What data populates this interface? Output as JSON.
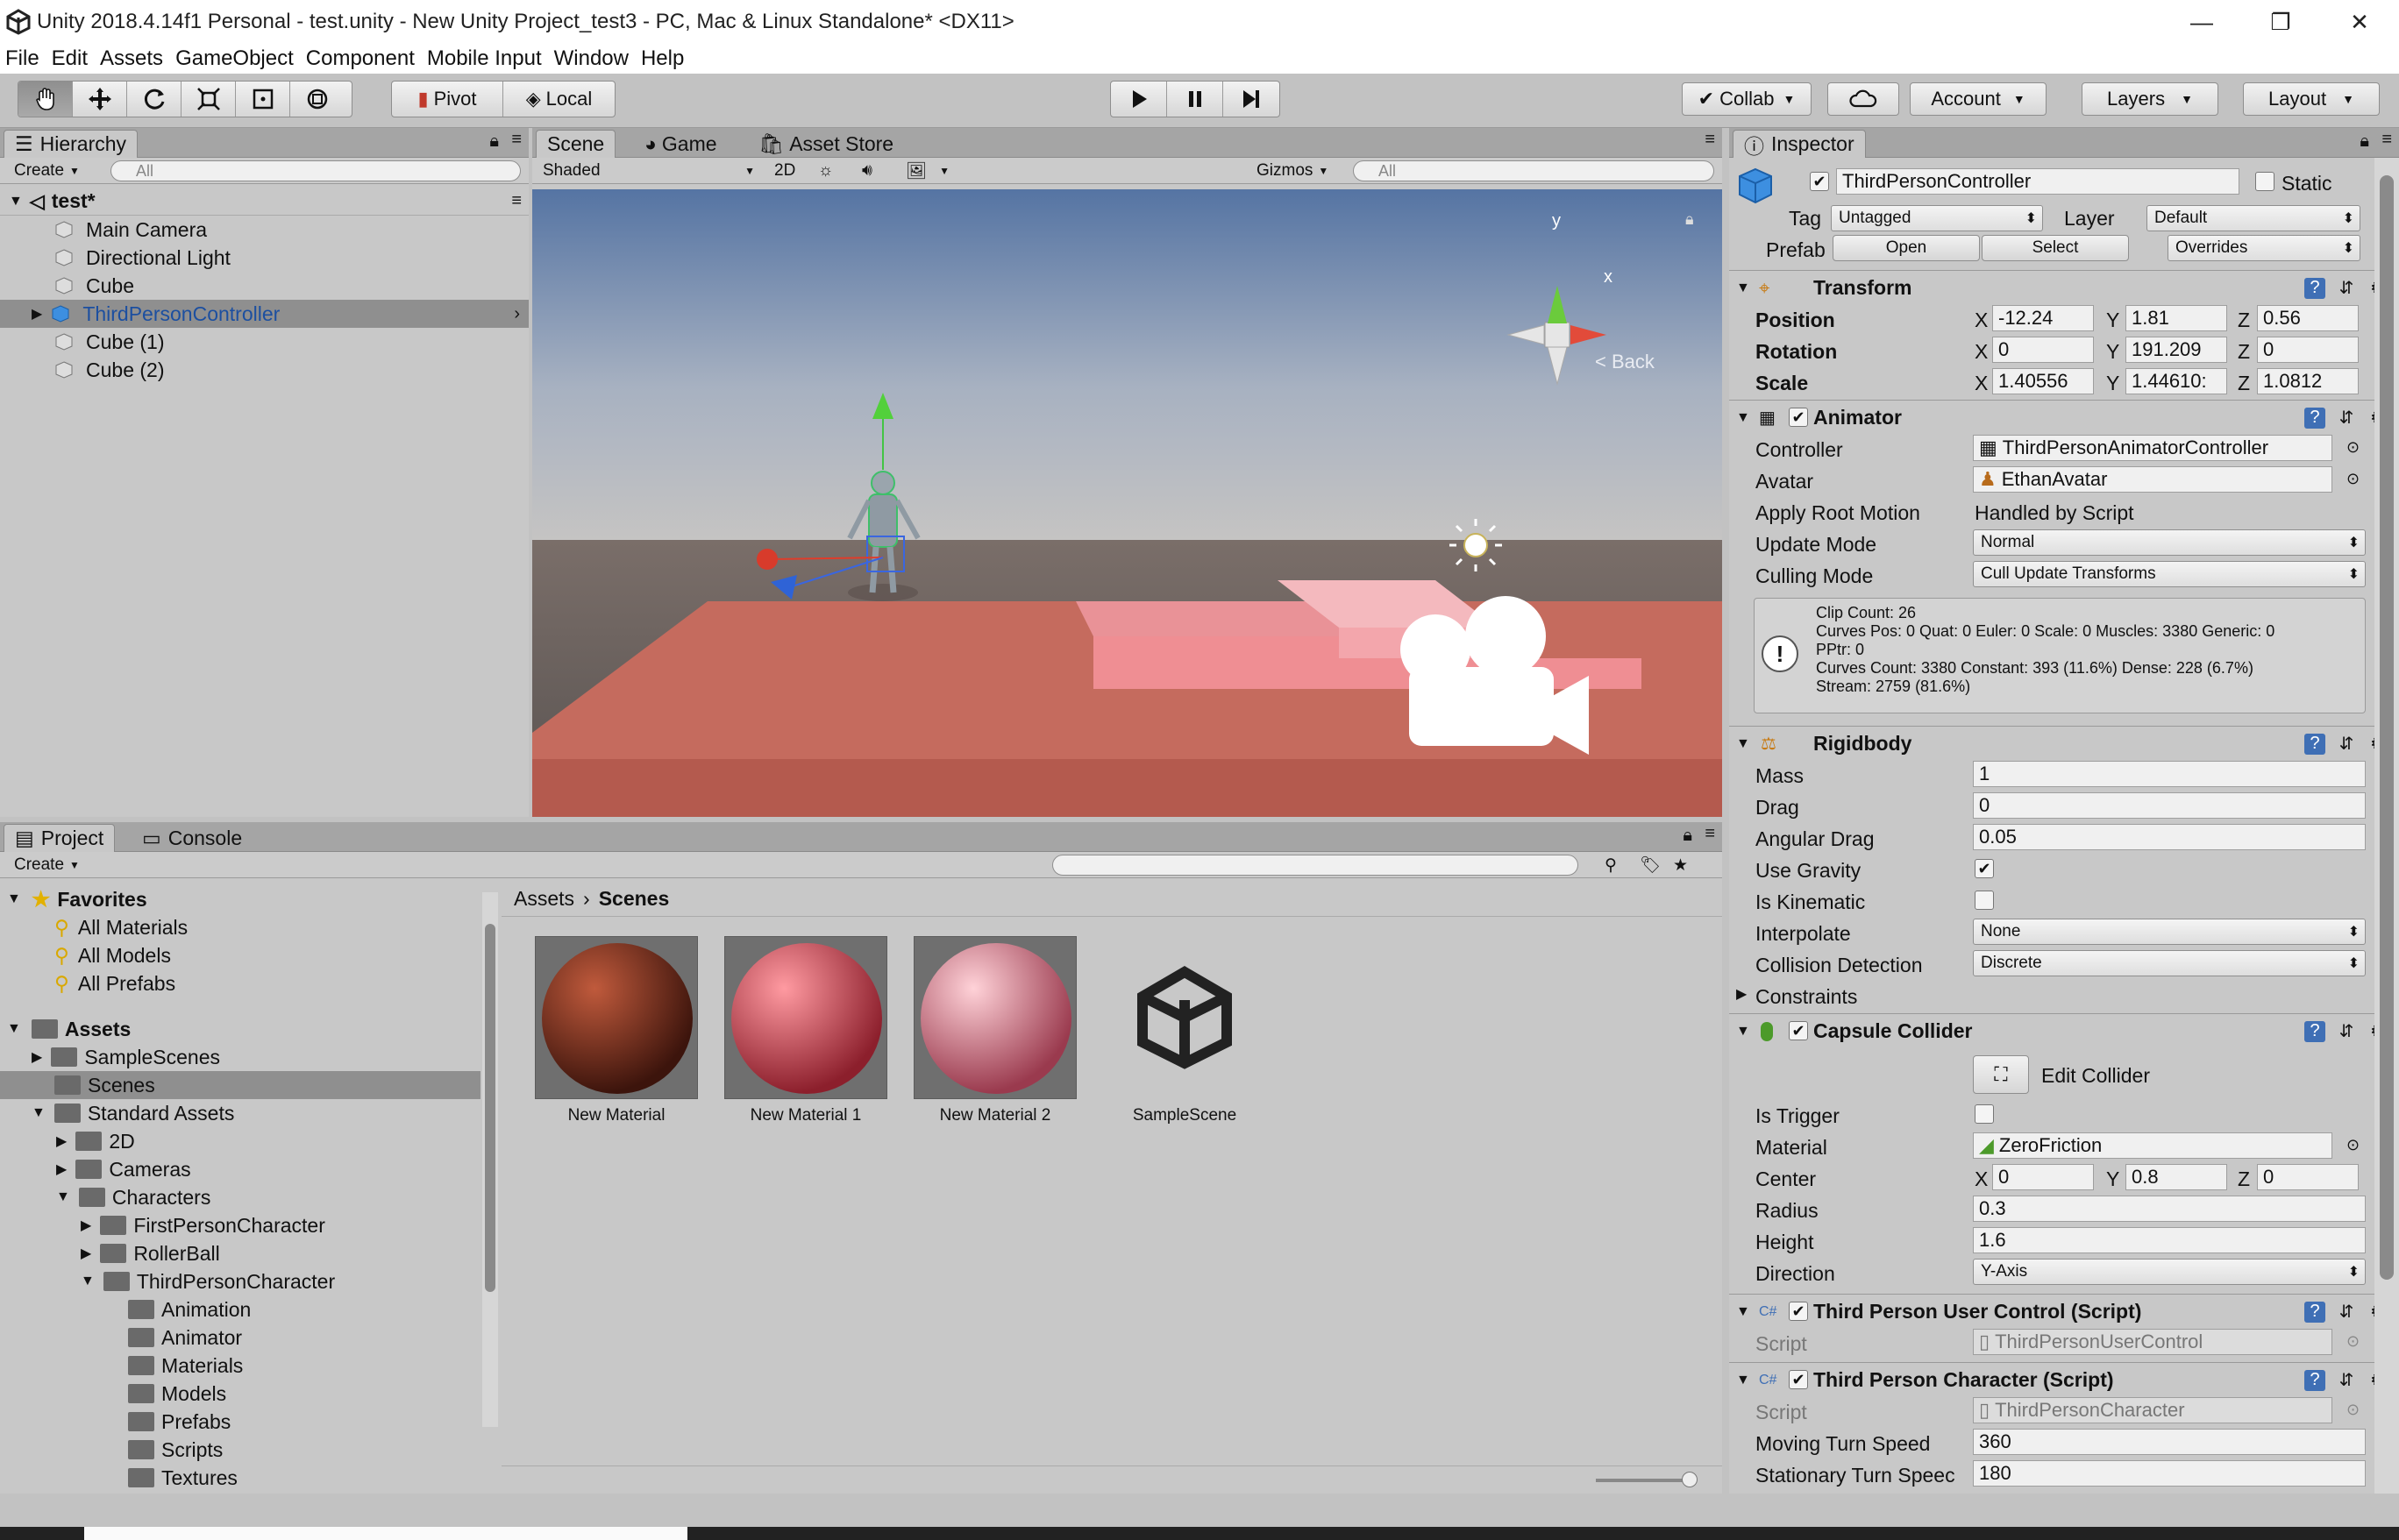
{
  "window": {
    "title": "Unity 2018.4.14f1 Personal - test.unity - New Unity Project_test3 - PC, Mac & Linux Standalone* <DX11>"
  },
  "menu": [
    "File",
    "Edit",
    "Assets",
    "GameObject",
    "Component",
    "Mobile Input",
    "Window",
    "Help"
  ],
  "toolbar": {
    "pivot": "Pivot",
    "local": "Local",
    "collab": "Collab",
    "account": "Account",
    "layers": "Layers",
    "layout": "Layout"
  },
  "hierarchy": {
    "tab": "Hierarchy",
    "create": "Create",
    "search": "All",
    "scene": "test*",
    "items": [
      "Main Camera",
      "Directional Light",
      "Cube",
      "ThirdPersonController",
      "Cube (1)",
      "Cube (2)"
    ]
  },
  "sceneview": {
    "tabs": [
      "Scene",
      "Game",
      "Asset Store"
    ],
    "shading": "Shaded",
    "mode2d": "2D",
    "gizmos": "Gizmos",
    "search": "All",
    "axis_y": "y",
    "axis_x": "x",
    "back": "< Back"
  },
  "project": {
    "tabs": [
      "Project",
      "Console"
    ],
    "create": "Create",
    "favorites": {
      "label": "Favorites",
      "items": [
        "All Materials",
        "All Models",
        "All Prefabs"
      ]
    },
    "assets_label": "Assets",
    "tree": [
      "SampleScenes",
      "Scenes",
      "Standard Assets",
      "2D",
      "Cameras",
      "Characters",
      "FirstPersonCharacter",
      "RollerBall",
      "ThirdPersonCharacter",
      "Animation",
      "Animator",
      "Materials",
      "Models",
      "Prefabs",
      "Scripts",
      "Textures"
    ],
    "breadcrumb": [
      "Assets",
      "Scenes"
    ],
    "assets": [
      "New Material",
      "New Material 1",
      "New Material 2",
      "SampleScene"
    ]
  },
  "inspector": {
    "tab": "Inspector",
    "object_name": "ThirdPersonController",
    "static": "Static",
    "tag_label": "Tag",
    "tag": "Untagged",
    "layer_label": "Layer",
    "layer": "Default",
    "prefab_label": "Prefab",
    "open": "Open",
    "select": "Select",
    "overrides": "Overrides",
    "transform": {
      "title": "Transform",
      "position": "Position",
      "rotation": "Rotation",
      "scale": "Scale",
      "pos": [
        "-12.24",
        "1.81",
        "0.56"
      ],
      "rot": [
        "0",
        "191.209",
        "0"
      ],
      "scl": [
        "1.40556",
        "1.44610:",
        "1.0812"
      ]
    },
    "animator": {
      "title": "Animator",
      "controller_label": "Controller",
      "controller": "ThirdPersonAnimatorController",
      "avatar_label": "Avatar",
      "avatar": "EthanAvatar",
      "root_label": "Apply Root Motion",
      "root": "Handled by Script",
      "update_label": "Update Mode",
      "update": "Normal",
      "culling_label": "Culling Mode",
      "culling": "Cull Update Transforms",
      "info": [
        "Clip Count: 26",
        "Curves Pos: 0 Quat: 0 Euler: 0 Scale: 0 Muscles: 3380 Generic: 0",
        "PPtr: 0",
        "Curves Count: 3380 Constant: 393 (11.6%) Dense: 228 (6.7%)",
        "Stream: 2759 (81.6%)"
      ]
    },
    "rigidbody": {
      "title": "Rigidbody",
      "mass_label": "Mass",
      "mass": "1",
      "drag_label": "Drag",
      "drag": "0",
      "adrag_label": "Angular Drag",
      "adrag": "0.05",
      "grav_label": "Use Gravity",
      "kin_label": "Is Kinematic",
      "interp_label": "Interpolate",
      "interp": "None",
      "coll_label": "Collision Detection",
      "coll": "Discrete",
      "constraints": "Constraints"
    },
    "capsule": {
      "title": "Capsule Collider",
      "edit": "Edit Collider",
      "trigger_label": "Is Trigger",
      "material_label": "Material",
      "material": "ZeroFriction",
      "center_label": "Center",
      "center": [
        "0",
        "0.8",
        "0"
      ],
      "radius_label": "Radius",
      "radius": "0.3",
      "height_label": "Height",
      "height": "1.6",
      "dir_label": "Direction",
      "dir": "Y-Axis"
    },
    "userctrl": {
      "title": "Third Person User Control (Script)",
      "script_label": "Script",
      "script": "ThirdPersonUserControl"
    },
    "character": {
      "title": "Third Person Character (Script)",
      "script_label": "Script",
      "script": "ThirdPersonCharacter",
      "moving_label": "Moving Turn Speed",
      "moving": "360",
      "stationary_label": "Stationary Turn Speec",
      "stationary": "180"
    }
  }
}
